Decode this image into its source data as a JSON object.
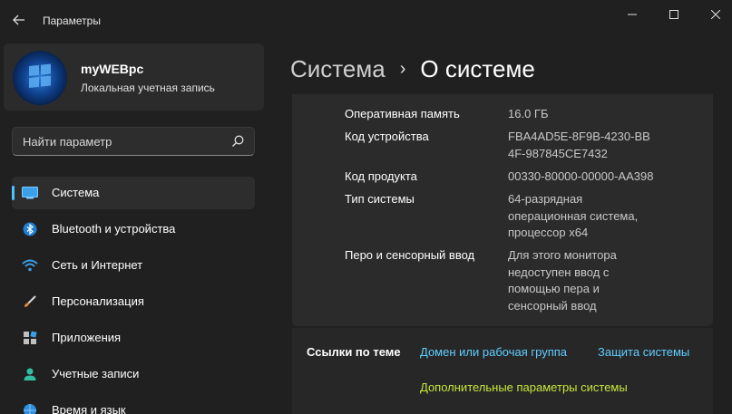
{
  "window": {
    "title": "Параметры"
  },
  "profile": {
    "name": "myWEBpc",
    "account_type": "Локальная учетная запись"
  },
  "search": {
    "placeholder": "Найти параметр"
  },
  "nav": {
    "items": [
      {
        "label": "Система",
        "icon": "display-icon",
        "active": true
      },
      {
        "label": "Bluetooth и устройства",
        "icon": "bluetooth-icon"
      },
      {
        "label": "Сеть и Интернет",
        "icon": "wifi-icon"
      },
      {
        "label": "Персонализация",
        "icon": "brush-icon"
      },
      {
        "label": "Приложения",
        "icon": "apps-icon"
      },
      {
        "label": "Учетные записи",
        "icon": "person-icon"
      },
      {
        "label": "Время и язык",
        "icon": "globe-icon"
      }
    ]
  },
  "breadcrumb": {
    "parent": "Система",
    "separator": "›",
    "current": "О системе"
  },
  "specs": [
    {
      "label": "Оперативная память",
      "value": "16.0 ГБ"
    },
    {
      "label": "Код устройства",
      "value": "FBA4AD5E-8F9B-4230-BB4F-987845CE7432"
    },
    {
      "label": "Код продукта",
      "value": "00330-80000-00000-AA398"
    },
    {
      "label": "Тип системы",
      "value": "64-разрядная операционная система, процессор x64"
    },
    {
      "label": "Перо и сенсорный ввод",
      "value": "Для этого монитора недоступен ввод с помощью пера и сенсорный ввод"
    }
  ],
  "related": {
    "title": "Ссылки по теме",
    "links": [
      "Домен или рабочая группа",
      "Защита системы",
      "Дополнительные параметры системы"
    ]
  },
  "colors": {
    "accent": "#4cc2ff",
    "link": "#60cdff",
    "highlight_link": "#c7e63a"
  }
}
